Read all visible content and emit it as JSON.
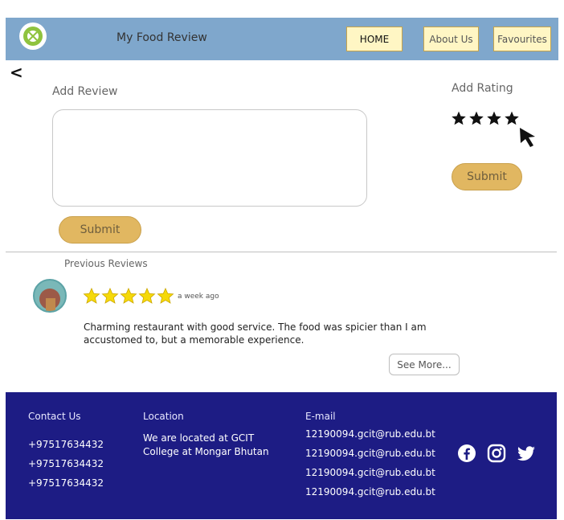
{
  "header": {
    "brand": "My Food Review",
    "nav": {
      "home": "HOME",
      "about": "About Us",
      "favourites": "Favourites"
    }
  },
  "back_icon": "<",
  "add_review": {
    "label": "Add Review",
    "placeholder": "",
    "submit_label": "Submit"
  },
  "add_rating": {
    "label": "Add Rating",
    "selected_stars": 4,
    "submit_label": "Submit"
  },
  "previous_reviews": {
    "label": "Previous Reviews",
    "items": [
      {
        "stars": 5,
        "time": "a week ago",
        "text": "Charming restaurant with good service. The food was spicier than I am accustomed to, but a memorable experience."
      }
    ],
    "see_more_label": "See More..."
  },
  "footer": {
    "contact": {
      "title": "Contact Us",
      "phones": [
        "+97517634432",
        "+97517634432",
        "+97517634432"
      ]
    },
    "location": {
      "title": "Location",
      "lines": [
        "We are located at GCIT",
        "College at Mongar Bhutan"
      ]
    },
    "email": {
      "title": "E-mail",
      "addresses": [
        "12190094.gcit@rub.edu.bt",
        "12190094.gcit@rub.edu.bt",
        "12190094.gcit@rub.edu.bt",
        "12190094.gcit@rub.edu.bt"
      ]
    },
    "social_icons": [
      "facebook-icon",
      "instagram-icon",
      "twitter-icon"
    ]
  },
  "colors": {
    "header_bg": "#7fa7cc",
    "nav_button_bg": "#fff6c4",
    "submit_bg": "#e1b761",
    "star_gold": "#f5d90a",
    "footer_bg": "#1d1c84"
  }
}
